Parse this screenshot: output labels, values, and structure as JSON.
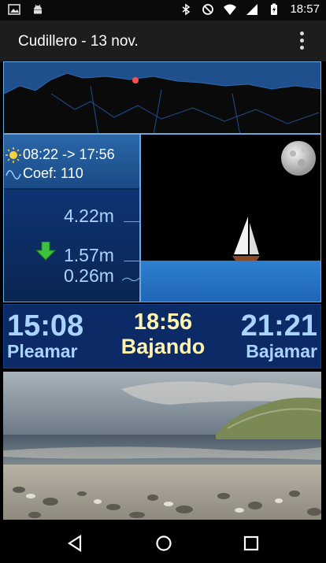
{
  "status_bar": {
    "time": "18:57",
    "icons": [
      "image-icon",
      "android-icon",
      "bluetooth-icon",
      "do-not-disturb-icon",
      "wifi-icon",
      "signal-icon",
      "battery-charging-icon"
    ]
  },
  "app_bar": {
    "title": "Cudillero - 13 nov.",
    "overflow_icon": "more-vert-icon"
  },
  "tide_info": {
    "sun_times": "08:22 -> 17:56",
    "coefficient": "Coef: 110",
    "high_level": "4.22m",
    "current_level": "1.57m",
    "low_level": "0.26m",
    "trend_icon": "arrow-down-icon"
  },
  "summary": {
    "high_tide_time": "15:08",
    "high_tide_label": "Pleamar",
    "current_time": "18:56",
    "current_state": "Bajando",
    "low_tide_time": "21:21",
    "low_tide_label": "Bajamar"
  },
  "colors": {
    "accent_blue": "#a8d4ff",
    "accent_yellow": "#fff3b0",
    "panel_blue": "#0c2a66",
    "arrow_green": "#3cc23c"
  },
  "nav_bar": {
    "back_icon": "back-triangle-icon",
    "home_icon": "home-circle-icon",
    "recents_icon": "recents-square-icon"
  }
}
